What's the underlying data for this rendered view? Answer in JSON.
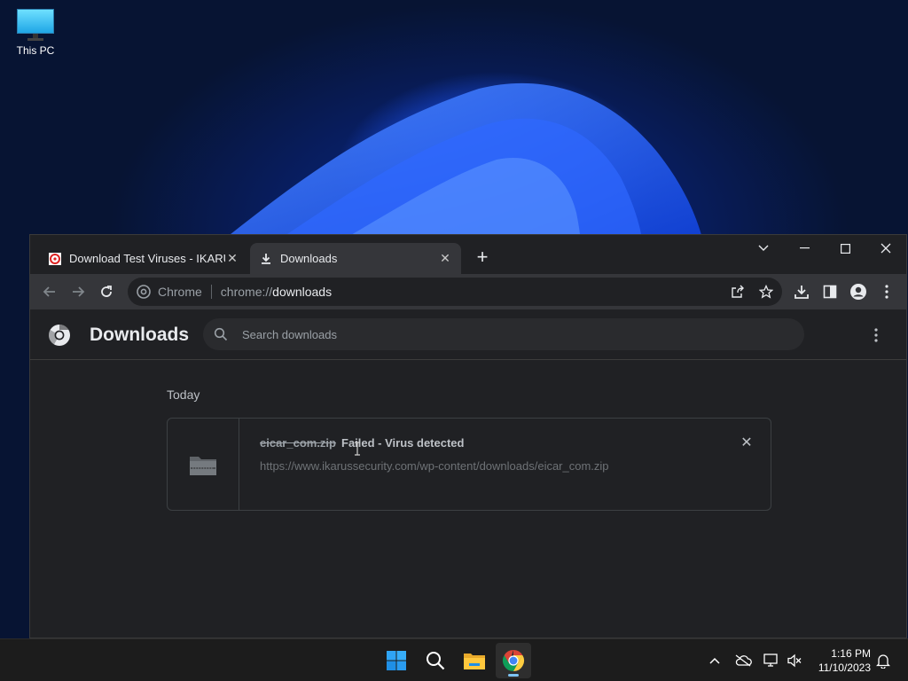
{
  "desktop": {
    "icons": [
      {
        "label": "This PC",
        "icon": "monitor-icon"
      }
    ]
  },
  "browser": {
    "tabs": [
      {
        "title": "Download Test Viruses - IKARUS",
        "icon": "ikarus-favicon",
        "active": false
      },
      {
        "title": "Downloads",
        "icon": "download-icon",
        "active": true
      }
    ],
    "omnibox": {
      "chip": "Chrome",
      "scheme": "chrome://",
      "host": "downloads"
    }
  },
  "downloads_page": {
    "title": "Downloads",
    "search_placeholder": "Search downloads",
    "section": "Today",
    "items": [
      {
        "file_name": "eicar_com.zip",
        "status": "Failed - Virus detected",
        "url": "https://www.ikarussecurity.com/wp-content/downloads/eicar_com.zip"
      }
    ]
  },
  "taskbar": {
    "apps": [
      "windows-start",
      "search",
      "file-explorer",
      "chrome"
    ],
    "clock": {
      "time": "1:16 PM",
      "date": "11/10/2023"
    }
  },
  "colors": {
    "window_bg": "#202124",
    "toolbar_bg": "#35363a",
    "accent": "#7ec3f2"
  }
}
